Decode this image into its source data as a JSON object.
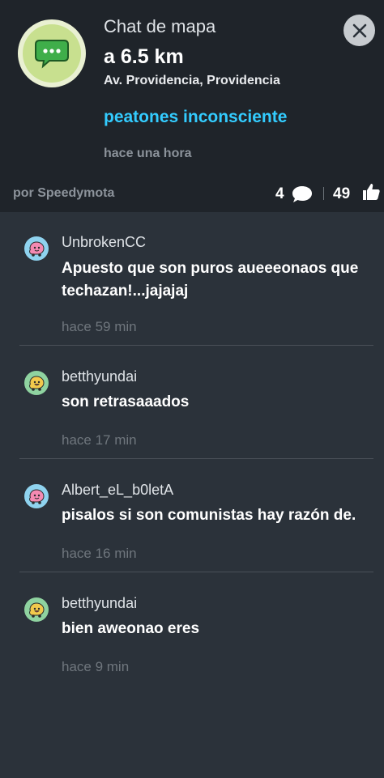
{
  "header": {
    "title": "Chat de mapa",
    "distance": "a 6.5 km",
    "address": "Av. Providencia, Providencia",
    "headline": "peatones inconsciente",
    "time": "hace una hora",
    "author": "por Speedymota",
    "comments_count": "4",
    "likes_count": "49",
    "icons": {
      "app": "chat-bubble-icon",
      "close": "close-icon",
      "comments": "comment-icon",
      "likes": "thumbs-up-icon"
    },
    "colors": {
      "accent": "#33ccff",
      "header_bg": "#1f242a",
      "body_bg": "#2b323a"
    }
  },
  "messages": [
    {
      "user": "UnbrokenCC",
      "text": "Apuesto que son puros aueeeonaos que techazan!...jajajaj",
      "time": "hace 59 min",
      "avatar": "wazer-pink-icon"
    },
    {
      "user": "betthyundai",
      "text": "son retrasaaados",
      "time": "hace 17 min",
      "avatar": "wazer-yellow-icon"
    },
    {
      "user": "Albert_eL_b0letA",
      "text": "pisalos si son comunistas hay razón de.",
      "time": "hace 16 min",
      "avatar": "wazer-pink-icon"
    },
    {
      "user": "betthyundai",
      "text": "bien aweonao eres",
      "time": "hace 9 min",
      "avatar": "wazer-yellow-icon"
    }
  ]
}
